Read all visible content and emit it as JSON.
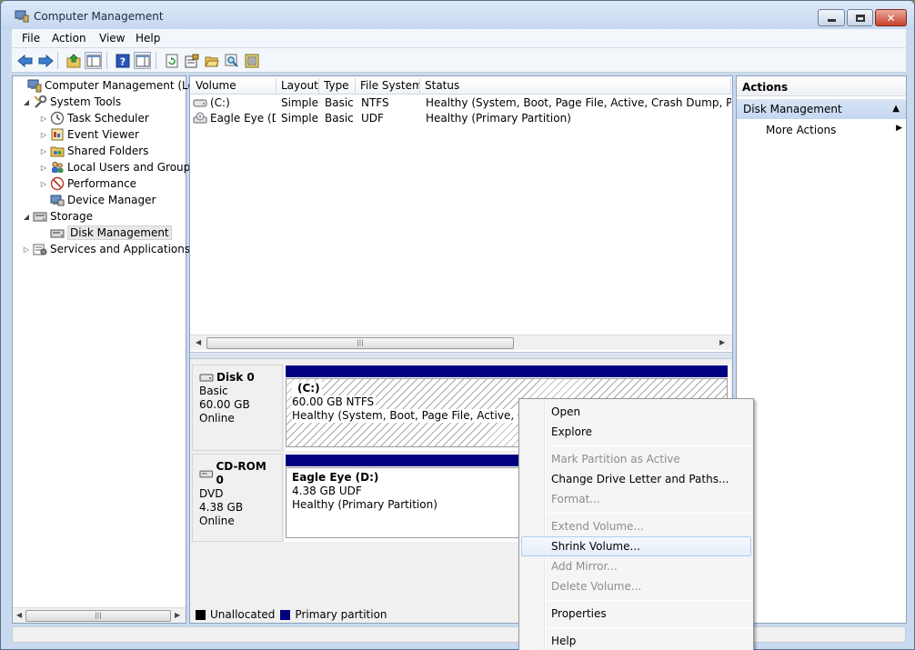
{
  "window": {
    "title": "Computer Management"
  },
  "menu": [
    "File",
    "Action",
    "View",
    "Help"
  ],
  "toolbar_icons": [
    "back-arrow-icon",
    "forward-arrow-icon",
    "up-folder-icon",
    "show-hide-console-tree-icon",
    "help-icon",
    "show-hide-action-pane-icon",
    "refresh-icon",
    "properties-icon",
    "open-folder-icon",
    "search-icon",
    "settings-icon"
  ],
  "tree": {
    "items": [
      {
        "label": "Computer Management (Local",
        "level": 0,
        "expander": "",
        "icon": "computer-management-icon"
      },
      {
        "label": "System Tools",
        "level": 1,
        "expander": "expanded",
        "icon": "system-tools-icon"
      },
      {
        "label": "Task Scheduler",
        "level": 2,
        "expander": "collapsed",
        "icon": "clock-icon"
      },
      {
        "label": "Event Viewer",
        "level": 2,
        "expander": "collapsed",
        "icon": "event-viewer-icon"
      },
      {
        "label": "Shared Folders",
        "level": 2,
        "expander": "collapsed",
        "icon": "shared-folders-icon"
      },
      {
        "label": "Local Users and Groups",
        "level": 2,
        "expander": "collapsed",
        "icon": "users-icon"
      },
      {
        "label": "Performance",
        "level": 2,
        "expander": "collapsed",
        "icon": "performance-icon"
      },
      {
        "label": "Device Manager",
        "level": 2,
        "expander": "",
        "icon": "device-manager-icon"
      },
      {
        "label": "Storage",
        "level": 1,
        "expander": "expanded",
        "icon": "storage-icon"
      },
      {
        "label": "Disk Management",
        "level": 2,
        "expander": "",
        "icon": "disk-management-icon",
        "selected": true
      },
      {
        "label": "Services and Applications",
        "level": 1,
        "expander": "collapsed",
        "icon": "services-icon"
      }
    ]
  },
  "volumes": {
    "columns": [
      "Volume",
      "Layout",
      "Type",
      "File System",
      "Status"
    ],
    "rows": [
      [
        "(C:)",
        "Simple",
        "Basic",
        "NTFS",
        "Healthy (System, Boot, Page File, Active, Crash Dump, Primary P"
      ],
      [
        "Eagle Eye (D:)",
        "Simple",
        "Basic",
        "UDF",
        "Healthy (Primary Partition)"
      ]
    ]
  },
  "disks": [
    {
      "name": "Disk 0",
      "type": "Basic",
      "size": "60.00 GB",
      "state": "Online",
      "volume": {
        "name": "(C:)",
        "size": "60.00 GB NTFS",
        "status": "Healthy (System, Boot, Page File, Active, Crash D"
      }
    },
    {
      "name": "CD-ROM 0",
      "type": "DVD",
      "size": "4.38 GB",
      "state": "Online",
      "volume": {
        "name": "Eagle Eye  (D:)",
        "size": "4.38 GB UDF",
        "status": "Healthy (Primary Partition)"
      }
    }
  ],
  "legend": [
    {
      "label": "Unallocated",
      "color": "#000000"
    },
    {
      "label": "Primary partition",
      "color": "#000080"
    }
  ],
  "actions": {
    "header": "Actions",
    "section": "Disk Management",
    "more": "More Actions"
  },
  "context_menu": {
    "items": [
      {
        "label": "Open",
        "enabled": true
      },
      {
        "label": "Explore",
        "enabled": true
      },
      {
        "sep": true
      },
      {
        "label": "Mark Partition as Active",
        "enabled": false
      },
      {
        "label": "Change Drive Letter and Paths...",
        "enabled": true
      },
      {
        "label": "Format...",
        "enabled": false
      },
      {
        "sep": true
      },
      {
        "label": "Extend Volume...",
        "enabled": false
      },
      {
        "label": "Shrink Volume...",
        "enabled": true,
        "hover": true
      },
      {
        "label": "Add Mirror...",
        "enabled": false
      },
      {
        "label": "Delete Volume...",
        "enabled": false
      },
      {
        "sep": true
      },
      {
        "label": "Properties",
        "enabled": true
      },
      {
        "sep": true
      },
      {
        "label": "Help",
        "enabled": true
      }
    ]
  },
  "colors": {
    "primary_partition": "#000080",
    "window_frame": "#c9daf0",
    "selection_hover": "#aecff7"
  }
}
